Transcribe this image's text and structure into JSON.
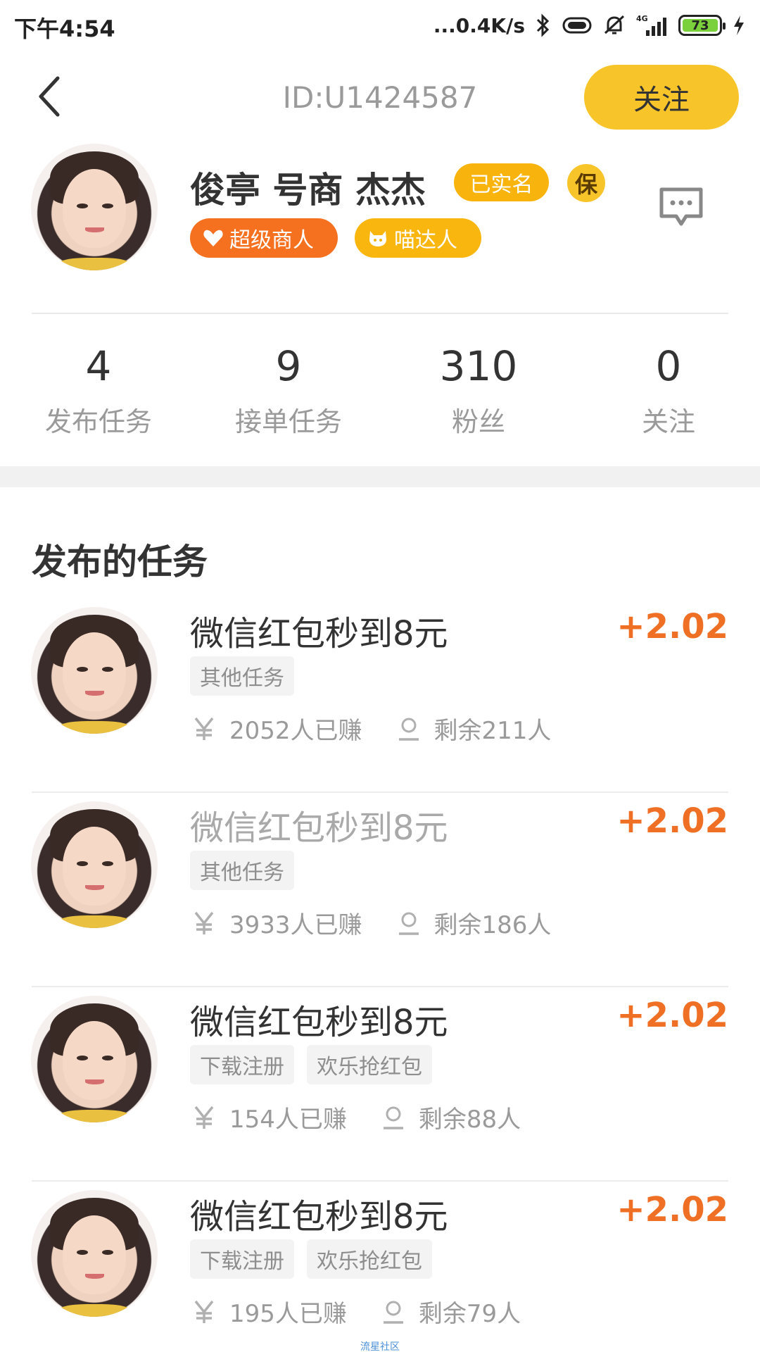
{
  "status_bar": {
    "time": "下午4:54",
    "net_speed": "...0.4K/s",
    "network": "4G",
    "battery": "73"
  },
  "header": {
    "user_id": "ID:U1424587",
    "follow_label": "关注"
  },
  "profile": {
    "name": "俊亭 号商 杰杰",
    "verified_badge": "已实名",
    "guarantee_badge": "保",
    "badges": [
      {
        "label": "超级商人",
        "icon": "heart-icon",
        "color": "#f5701f"
      },
      {
        "label": "喵达人",
        "icon": "cat-icon",
        "color": "#f8b60e"
      }
    ]
  },
  "stats": [
    {
      "value": "4",
      "label": "发布任务"
    },
    {
      "value": "9",
      "label": "接单任务"
    },
    {
      "value": "310",
      "label": "粉丝"
    },
    {
      "value": "0",
      "label": "关注"
    }
  ],
  "section_title": "发布的任务",
  "tasks": [
    {
      "title": "微信红包秒到8元",
      "reward": "+2.02",
      "tags": [
        "其他任务"
      ],
      "earned": "2052人已赚",
      "remaining": "剩余211人"
    },
    {
      "title": "微信红包秒到8元",
      "reward": "+2.02",
      "tags": [
        "其他任务"
      ],
      "earned": "3933人已赚",
      "remaining": "剩余186人"
    },
    {
      "title": "微信红包秒到8元",
      "reward": "+2.02",
      "tags": [
        "下载注册",
        "欢乐抢红包"
      ],
      "earned": "154人已赚",
      "remaining": "剩余88人"
    },
    {
      "title": "微信红包秒到8元",
      "reward": "+2.02",
      "tags": [
        "下载注册",
        "欢乐抢红包"
      ],
      "earned": "195人已赚",
      "remaining": "剩余79人"
    }
  ],
  "footer_watermark": "流星社区",
  "colors": {
    "accent_yellow": "#f7c52a",
    "reward_orange": "#ef7025"
  }
}
